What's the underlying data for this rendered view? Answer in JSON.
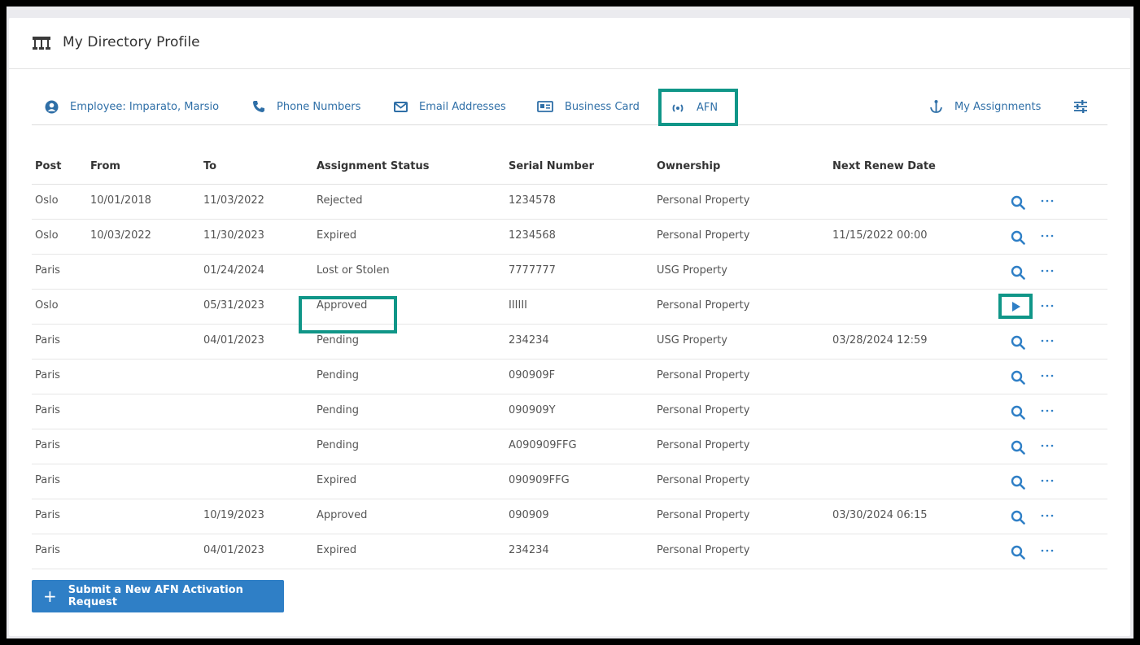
{
  "header": {
    "title": "My Directory Profile",
    "icon": "directory-icon"
  },
  "tabs": [
    {
      "label": "Employee: Imparato, Marsio",
      "icon": "user-circle-icon"
    },
    {
      "label": "Phone Numbers",
      "icon": "phone-icon"
    },
    {
      "label": "Email Addresses",
      "icon": "envelope-icon"
    },
    {
      "label": "Business Card",
      "icon": "id-card-icon"
    },
    {
      "label": "AFN",
      "icon": "signal-icon"
    },
    {
      "label": "My Assignments",
      "icon": "anchor-icon"
    }
  ],
  "settings_icon": "sliders-icon",
  "table": {
    "headers": [
      "Post",
      "From",
      "To",
      "Assignment Status",
      "Serial Number",
      "Ownership",
      "Next Renew Date"
    ],
    "rows": [
      {
        "post": "Oslo",
        "from": "10/01/2018",
        "to": "11/03/2022",
        "status": "Rejected",
        "serial": "1234578",
        "ownership": "Personal Property",
        "renew": ""
      },
      {
        "post": "Oslo",
        "from": "10/03/2022",
        "to": "11/30/2023",
        "status": "Expired",
        "serial": "1234568",
        "ownership": "Personal Property",
        "renew": "11/15/2022 00:00"
      },
      {
        "post": "Paris",
        "from": "",
        "to": "01/24/2024",
        "status": "Lost or Stolen",
        "serial": "7777777",
        "ownership": "USG Property",
        "renew": ""
      },
      {
        "post": "Oslo",
        "from": "",
        "to": "05/31/2023",
        "status": "Approved",
        "serial": "IIIIII",
        "ownership": "Personal Property",
        "renew": ""
      },
      {
        "post": "Paris",
        "from": "",
        "to": "04/01/2023",
        "status": "Pending",
        "serial": "234234",
        "ownership": "USG Property",
        "renew": "03/28/2024 12:59"
      },
      {
        "post": "Paris",
        "from": "",
        "to": "",
        "status": "Pending",
        "serial": "090909F",
        "ownership": "Personal Property",
        "renew": ""
      },
      {
        "post": "Paris",
        "from": "",
        "to": "",
        "status": "Pending",
        "serial": "090909Y",
        "ownership": "Personal Property",
        "renew": ""
      },
      {
        "post": "Paris",
        "from": "",
        "to": "",
        "status": "Pending",
        "serial": "A090909FFG",
        "ownership": "Personal Property",
        "renew": ""
      },
      {
        "post": "Paris",
        "from": "",
        "to": "",
        "status": "Expired",
        "serial": "090909FFG",
        "ownership": "Personal Property",
        "renew": ""
      },
      {
        "post": "Paris",
        "from": "",
        "to": "10/19/2023",
        "status": "Approved",
        "serial": "090909",
        "ownership": "Personal Property",
        "renew": "03/30/2024 06:15"
      },
      {
        "post": "Paris",
        "from": "",
        "to": "04/01/2023",
        "status": "Expired",
        "serial": "234234",
        "ownership": "Personal Property",
        "renew": ""
      }
    ]
  },
  "submit_label": "Submit a New AFN Activation Request",
  "colors": {
    "link": "#2f6fa7",
    "primary": "#2f7fc6",
    "highlight": "#109688"
  }
}
